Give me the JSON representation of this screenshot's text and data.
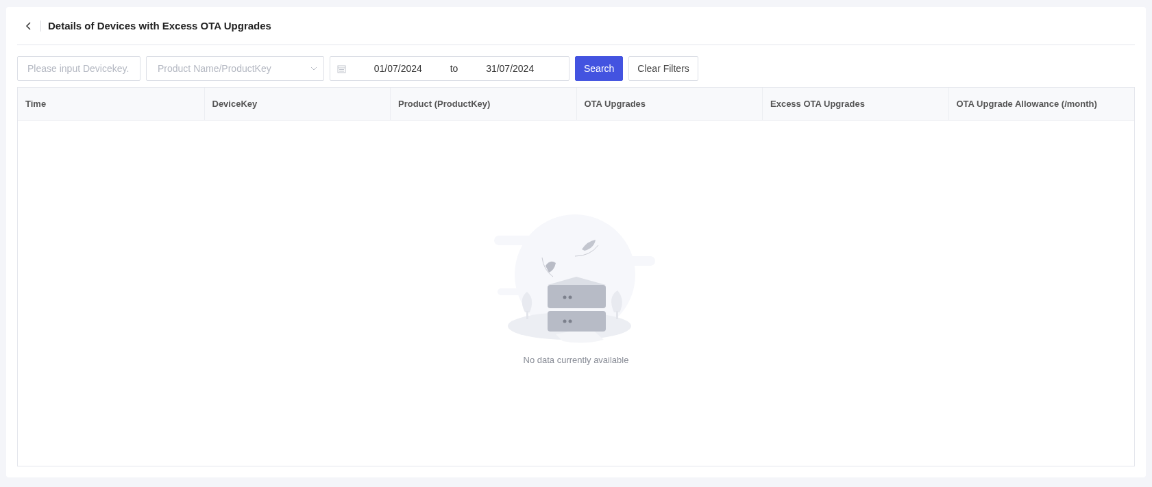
{
  "header": {
    "title": "Details of Devices with Excess OTA Upgrades"
  },
  "filters": {
    "devicekey": {
      "placeholder": "Please input Devicekey."
    },
    "product": {
      "placeholder": "Product Name/ProductKey"
    },
    "date_range": {
      "start": "01/07/2024",
      "separator": "to",
      "end": "31/07/2024"
    },
    "buttons": [
      {
        "label": "Search",
        "kind": "primary"
      },
      {
        "label": "Clear Filters",
        "kind": "default"
      }
    ]
  },
  "table": {
    "columns": [
      "Time",
      "DeviceKey",
      "Product (ProductKey)",
      "OTA Upgrades",
      "Excess OTA Upgrades",
      "OTA Upgrade Allowance (/month)"
    ],
    "empty_text": "No data currently available"
  }
}
